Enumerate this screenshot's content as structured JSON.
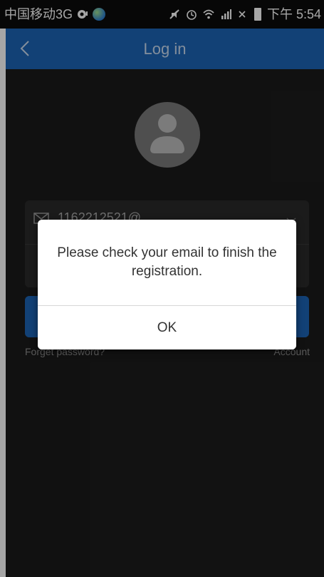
{
  "status_bar": {
    "carrier": "中国移动3G",
    "time": "下午 5:54"
  },
  "app_bar": {
    "title": "Log in",
    "back_icon": "chevron-left-icon"
  },
  "login_form": {
    "email_partial": "116221252­1@",
    "forgot_password": "Forget password?",
    "account_link": "Account"
  },
  "dialog": {
    "message": "Please check your email to finish the registration.",
    "ok_label": "OK"
  },
  "colors": {
    "primary": "#1c65b5",
    "background": "#1b1b1b",
    "dialog_bg": "#ffffff"
  }
}
